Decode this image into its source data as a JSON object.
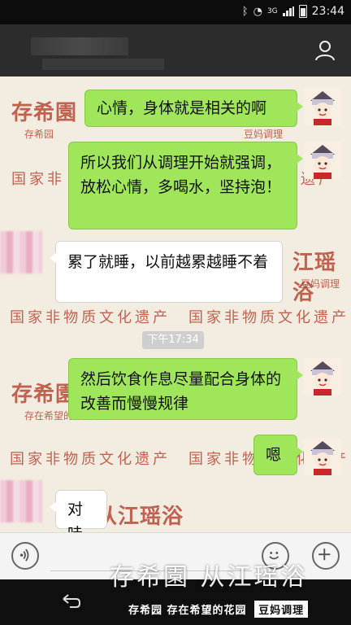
{
  "status": {
    "signal_label": "3G",
    "time": "23:44"
  },
  "messages": [
    {
      "from": "me",
      "text": "心情，身体就是相关的啊"
    },
    {
      "from": "me",
      "text": "所以我们从调理开始就强调，放松心情，多喝水，坚持泡！"
    },
    {
      "from": "them",
      "text": "累了就睡，以前越累越睡不着"
    },
    {
      "from": "me",
      "text": "然后饮食作息尽量配合身体的改善而慢慢规律"
    },
    {
      "from": "me",
      "text": "嗯"
    },
    {
      "from": "them",
      "text": "对哇"
    }
  ],
  "timestamp": "下午17:34",
  "watermark": {
    "logo": "存希園",
    "slogan": "存希园 存在希望的花园",
    "badge": "豆妈调理",
    "brand_full": "存希園 从江瑶浴",
    "heritage": "国家非物质文化遗产",
    "row_a": "国家非",
    "row_b": "化遗产",
    "small_left": "存希园",
    "small_mid": "存在希望的花园",
    "small_badge": "豆妈调理",
    "yaoyu": "从江瑶浴",
    "yaoyu_short": "江瑶浴",
    "heritage_short": "文化遗产"
  },
  "colors": {
    "bubble_me": "#9fe65b",
    "bubble_them": "#ffffff",
    "watermark": "#b94a39"
  }
}
